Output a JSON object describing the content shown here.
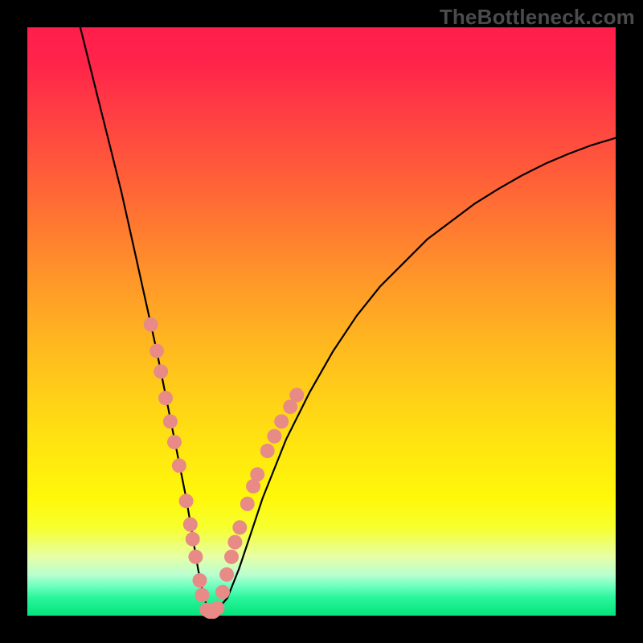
{
  "watermark": {
    "text": "TheBottleneck.com"
  },
  "colors": {
    "background": "#000000",
    "marker": "#e88b87",
    "curve": "#000000"
  },
  "chart_data": {
    "type": "line",
    "title": "",
    "xlabel": "",
    "ylabel": "",
    "xlim": [
      0,
      100
    ],
    "ylim": [
      0,
      100
    ],
    "grid": false,
    "legend": false,
    "series": [
      {
        "name": "bottleneck-curve",
        "x": [
          9,
          10,
          12,
          14,
          16,
          18,
          20,
          22,
          24,
          25,
          26,
          27,
          28,
          29,
          30,
          31,
          32,
          34,
          36,
          38,
          40,
          44,
          48,
          52,
          56,
          60,
          64,
          68,
          72,
          76,
          80,
          84,
          88,
          92,
          96,
          100
        ],
        "y": [
          100,
          96,
          88,
          80,
          72,
          63,
          54,
          45,
          35,
          30,
          25,
          20,
          14,
          8,
          3,
          0.7,
          0.7,
          3,
          8,
          14,
          20,
          30,
          38,
          45,
          51,
          56,
          60,
          64,
          67,
          70,
          72.5,
          74.8,
          76.8,
          78.5,
          80,
          81.2
        ]
      }
    ],
    "markers": [
      {
        "x": 21.0,
        "y": 49.5
      },
      {
        "x": 22.0,
        "y": 45.0
      },
      {
        "x": 22.7,
        "y": 41.5
      },
      {
        "x": 23.5,
        "y": 37.0
      },
      {
        "x": 24.3,
        "y": 33.0
      },
      {
        "x": 25.0,
        "y": 29.5
      },
      {
        "x": 25.8,
        "y": 25.5
      },
      {
        "x": 27.0,
        "y": 19.5
      },
      {
        "x": 27.7,
        "y": 15.5
      },
      {
        "x": 28.1,
        "y": 13.0
      },
      {
        "x": 28.6,
        "y": 10.0
      },
      {
        "x": 29.3,
        "y": 6.0
      },
      {
        "x": 29.7,
        "y": 3.5
      },
      {
        "x": 30.5,
        "y": 1.0
      },
      {
        "x": 31.0,
        "y": 0.7
      },
      {
        "x": 31.6,
        "y": 0.7
      },
      {
        "x": 32.3,
        "y": 1.3
      },
      {
        "x": 33.2,
        "y": 4.0
      },
      {
        "x": 33.9,
        "y": 7.0
      },
      {
        "x": 34.7,
        "y": 10.0
      },
      {
        "x": 35.3,
        "y": 12.5
      },
      {
        "x": 36.1,
        "y": 15.0
      },
      {
        "x": 37.4,
        "y": 19.0
      },
      {
        "x": 38.4,
        "y": 22.0
      },
      {
        "x": 39.1,
        "y": 24.0
      },
      {
        "x": 40.8,
        "y": 28.0
      },
      {
        "x": 42.0,
        "y": 30.5
      },
      {
        "x": 43.2,
        "y": 33.0
      },
      {
        "x": 44.7,
        "y": 35.5
      },
      {
        "x": 45.8,
        "y": 37.5
      }
    ]
  }
}
